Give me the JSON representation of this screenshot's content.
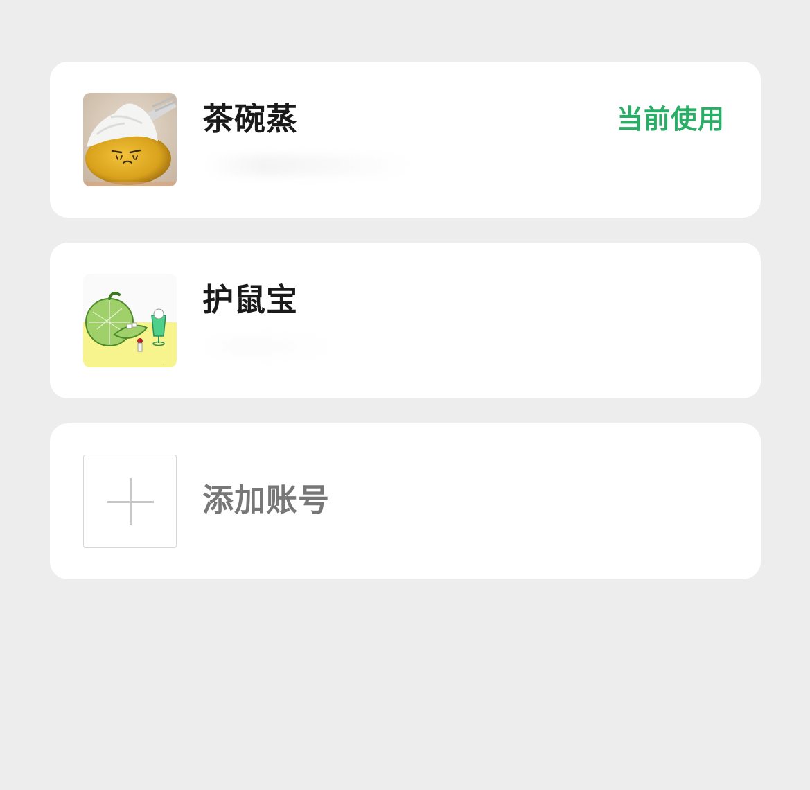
{
  "accounts": [
    {
      "name": "茶碗蒸",
      "status": "当前使用",
      "status_color": "#2aae67",
      "avatar_icon": "cream-puff-avatar"
    },
    {
      "name": "护鼠宝",
      "avatar_icon": "melon-illustration-avatar"
    }
  ],
  "add_account": {
    "label": "添加账号",
    "icon": "plus-icon"
  },
  "colors": {
    "background": "#ededed",
    "card": "#ffffff",
    "accent_green": "#2aae67"
  }
}
